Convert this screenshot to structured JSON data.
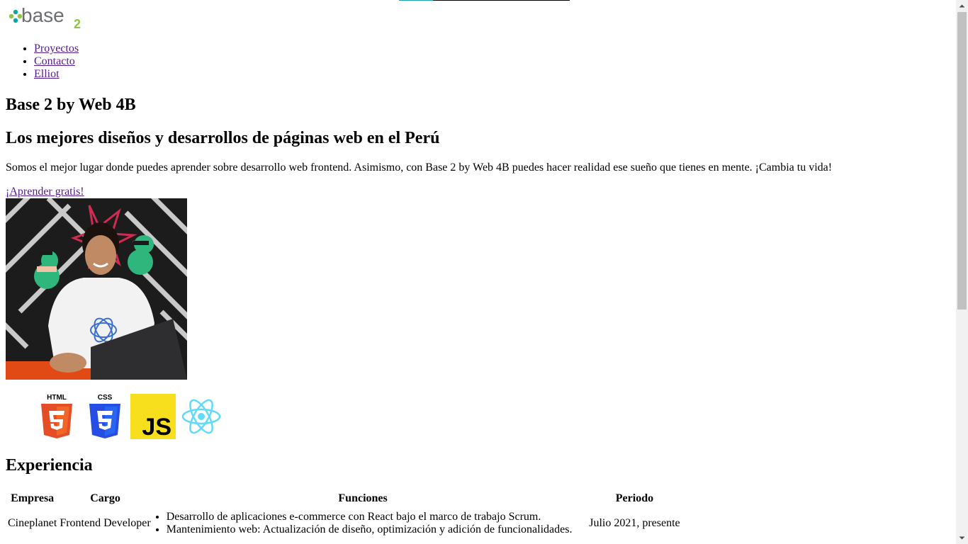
{
  "brand": {
    "logo_text": "base",
    "logo_subscript": "2",
    "colors": {
      "green": "#8dc63f",
      "teal": "#0aa5a5",
      "gray": "#6d6e71"
    }
  },
  "nav": {
    "items": [
      {
        "label": "Proyectos"
      },
      {
        "label": "Contacto"
      },
      {
        "label": "Elliot"
      }
    ]
  },
  "hero": {
    "title": "Base 2 by Web 4B",
    "subtitle": "Los mejores diseños y desarrollos de páginas web en el Perú",
    "intro": "Somos el mejor lugar donde puedes aprender sobre desarrollo web frontend. Asimismo, con Base 2 by Web 4B puedes hacer realidad ese sueño que tienes en mente. ¡Cambia tu vida!",
    "cta_label": "¡Aprender gratis!",
    "photo_alt": "person-at-laptop-photo"
  },
  "tech_icons": [
    {
      "name": "html5-icon",
      "label": "HTML",
      "color": "#e44d26"
    },
    {
      "name": "css3-icon",
      "label": "CSS",
      "color": "#264de4"
    },
    {
      "name": "javascript-icon",
      "label": "JS",
      "color": "#f7df1e"
    },
    {
      "name": "react-icon",
      "label": "",
      "color": "#61dafb"
    }
  ],
  "experience": {
    "heading": "Experiencia",
    "columns": [
      "Empresa",
      "Cargo",
      "Funciones",
      "Periodo"
    ],
    "rows": [
      {
        "empresa": "Cineplanet",
        "cargo": "Frontend Developer",
        "funciones": [
          "Desarrollo de aplicaciones e-commerce con React bajo el marco de trabajo Scrum.",
          "Mantenimiento web: Actualización de diseño, optimización y adición de funcionalidades."
        ],
        "periodo": "Julio 2021, presente"
      }
    ]
  }
}
